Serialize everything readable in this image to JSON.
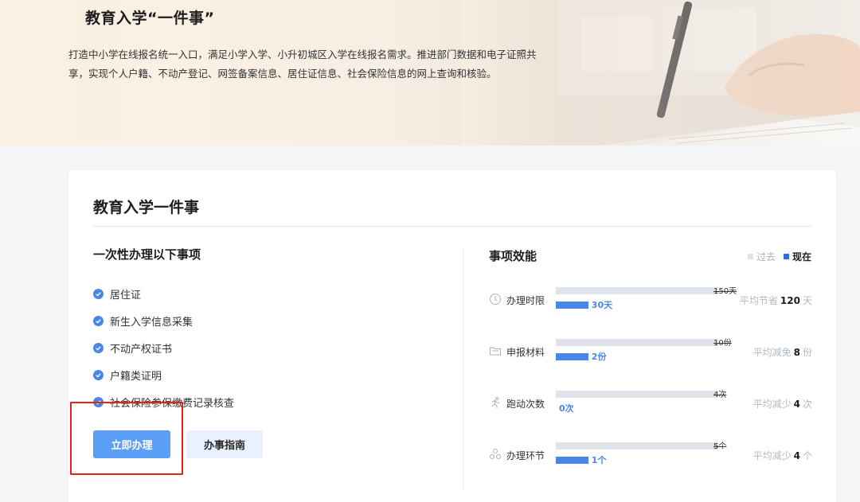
{
  "banner": {
    "title": "教育入学“一件事”",
    "description": "打造中小学在线报名统一入口，满足小学入学、小升初城区入学在线报名需求。推进部门数据和电子证照共享，实现个人户籍、不动产登记、网签备案信息、居住证信息、社会保险信息的网上查询和核验。"
  },
  "card": {
    "title": "教育入学一件事",
    "left_heading": "一次性办理以下事项",
    "items": [
      "居住证",
      "新生入学信息采集",
      "不动产权证书",
      "户籍类证明",
      "社会保险参保缴费记录核查"
    ],
    "primary_button": "立即办理",
    "secondary_button": "办事指南"
  },
  "efficiency": {
    "heading": "事项效能",
    "legend_past": "过去",
    "legend_now": "现在",
    "metrics": [
      {
        "icon": "clock-icon",
        "label": "办理时限",
        "past": "150天",
        "now": "30天",
        "past_value": 150,
        "now_value": 30,
        "save_prefix": "平均节省",
        "save_value": "120",
        "save_unit": "天"
      },
      {
        "icon": "folder-icon",
        "label": "申报材料",
        "past": "10份",
        "now": "2份",
        "past_value": 10,
        "now_value": 2,
        "save_prefix": "平均减免",
        "save_value": "8",
        "save_unit": "份"
      },
      {
        "icon": "runner-icon",
        "label": "跑动次数",
        "past": "4次",
        "now": "0次",
        "past_value": 4,
        "now_value": 0,
        "save_prefix": "平均减少",
        "save_value": "4",
        "save_unit": "次"
      },
      {
        "icon": "cycle-icon",
        "label": "办理环节",
        "past": "5个",
        "now": "1个",
        "past_value": 5,
        "now_value": 1,
        "save_prefix": "平均减少",
        "save_value": "4",
        "save_unit": "个"
      }
    ]
  },
  "colors": {
    "accent": "#4a86e8",
    "button_primary": "#5b9ef8",
    "button_secondary": "#e8f1fd",
    "bar_past": "#dfe3ea",
    "highlight": "#e2231a"
  }
}
